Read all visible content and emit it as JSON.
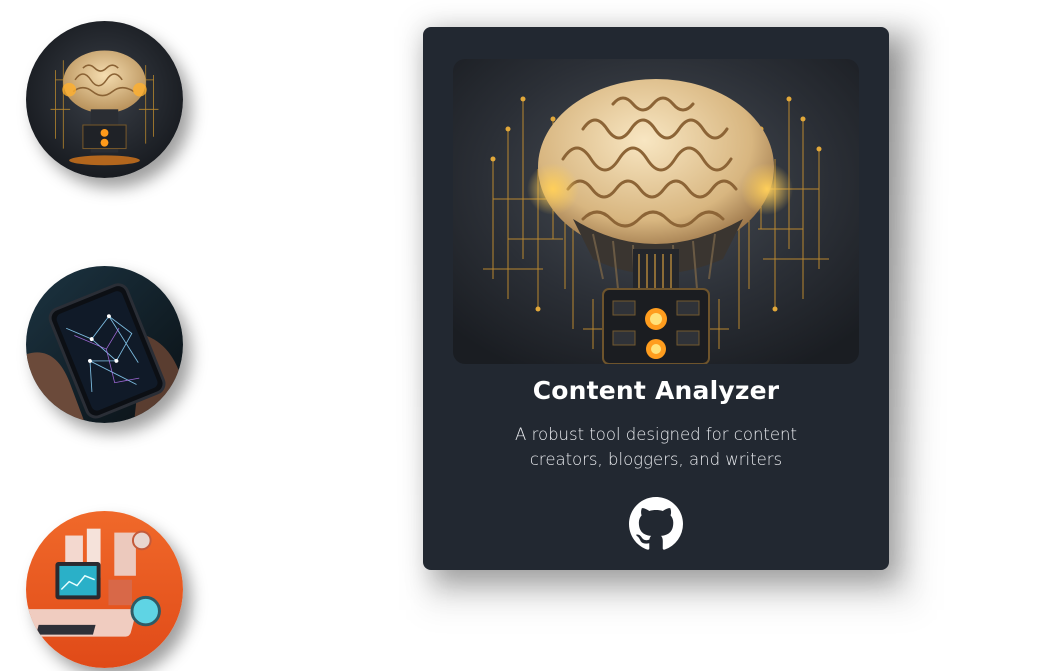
{
  "thumbnails": [
    {
      "name": "ai-brain-circuit",
      "icon": "brain-circuit-image"
    },
    {
      "name": "smartphone-network",
      "icon": "phone-network-image"
    },
    {
      "name": "retro-computer-machine",
      "icon": "computer-machine-image"
    }
  ],
  "card": {
    "title": "Content Analyzer",
    "description_line1": "A robust tool designed for content",
    "description_line2": "creators, bloggers, and writers",
    "image": "brain-circuit-image",
    "link_icon": "github-icon"
  },
  "colors": {
    "card_bg": "#222831",
    "title": "#ffffff",
    "accent_glow": "#f5a623"
  }
}
